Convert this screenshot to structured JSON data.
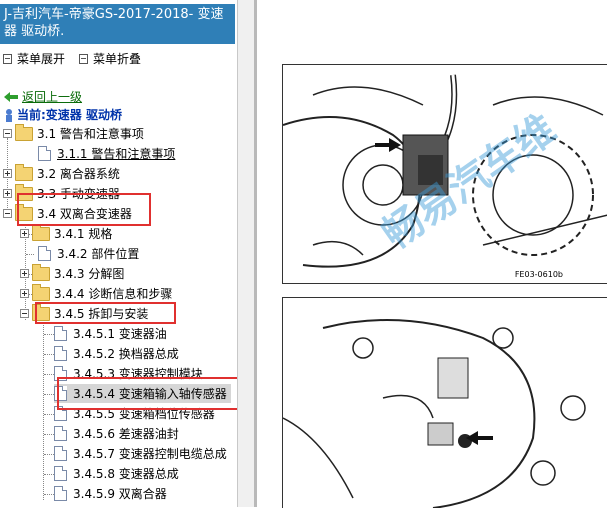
{
  "sidebar": {
    "title": "J-吉利汽车-帝豪GS-2017-2018- 变速器 驱动桥.",
    "expand_label": "菜单展开",
    "collapse_label": "菜单折叠",
    "up_label": "返回上一级",
    "current_label": "当前:变速器 驱动桥",
    "tree": [
      {
        "label": "3.1 警告和注意事项"
      },
      {
        "label": "3.1.1 警告和注意事项"
      },
      {
        "label": "3.2 离合器系统"
      },
      {
        "label": "3.3 手动变速器"
      },
      {
        "label": "3.4 双离合变速器"
      },
      {
        "label": "3.4.1 规格"
      },
      {
        "label": "3.4.2 部件位置"
      },
      {
        "label": "3.4.3 分解图"
      },
      {
        "label": "3.4.4 诊断信息和步骤"
      },
      {
        "label": "3.4.5 拆卸与安装"
      },
      {
        "label": "3.4.5.1 变速器油"
      },
      {
        "label": "3.4.5.2 换档器总成"
      },
      {
        "label": "3.4.5.3 变速器控制模块"
      },
      {
        "label": "3.4.5.4 变速箱输入轴传感器"
      },
      {
        "label": "3.4.5.5 变速箱档位传感器"
      },
      {
        "label": "3.4.5.6 差速器油封"
      },
      {
        "label": "3.4.5.7 变速器控制电缆总成"
      },
      {
        "label": "3.4.5.8 变速器总成"
      },
      {
        "label": "3.4.5.9 双离合器"
      }
    ]
  },
  "figure": {
    "label_top": "FE03-0610b",
    "watermark": "畅易汽车维"
  },
  "colors": {
    "title_bg": "#2f7fb7",
    "highlight_box": "#e0302f",
    "selected_bg": "#d6d6d6"
  }
}
